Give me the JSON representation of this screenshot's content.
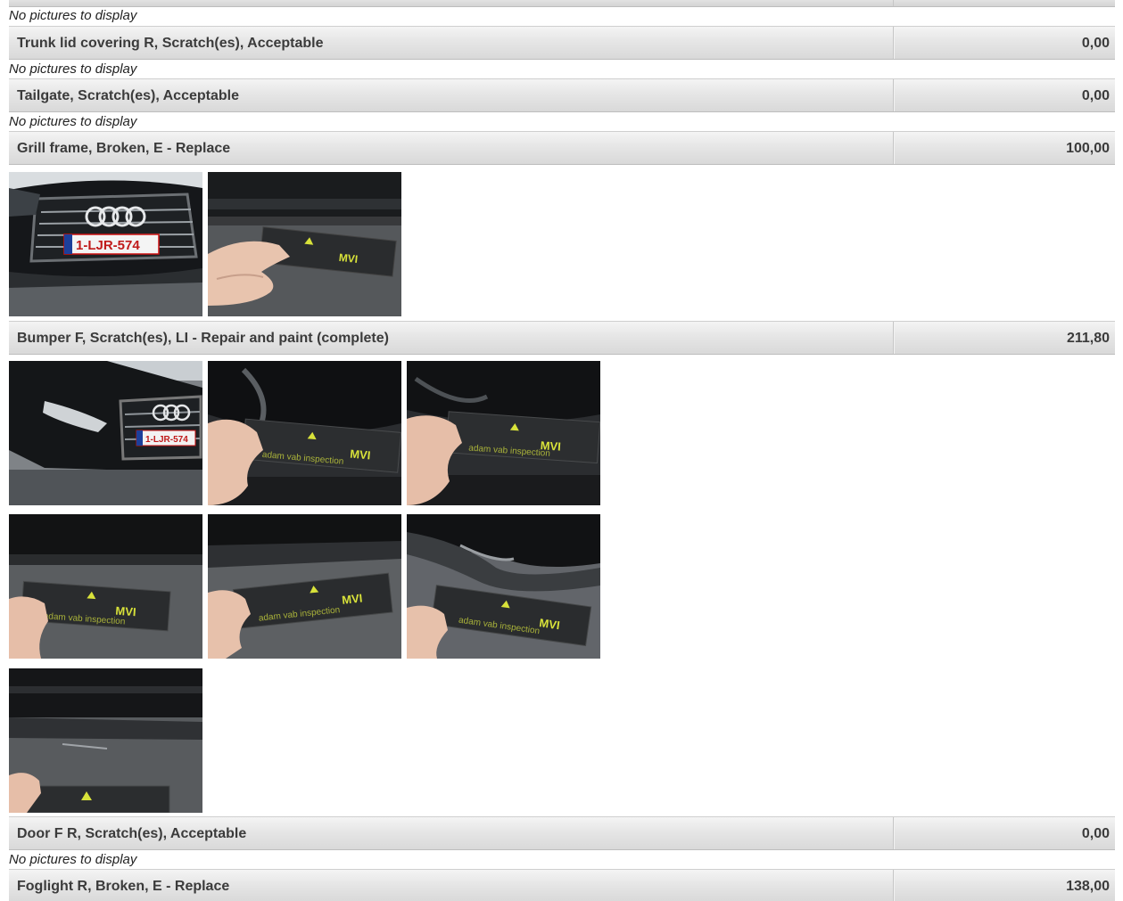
{
  "no_pictures_text": "No pictures to display",
  "items": [
    {
      "description": "Trunk lid covering R, Scratch(es), Acceptable",
      "amount": "0,00"
    },
    {
      "description": "Tailgate, Scratch(es), Acceptable",
      "amount": "0,00"
    },
    {
      "description": "Grill frame, Broken, E - Replace",
      "amount": "100,00"
    },
    {
      "description": "Bumper F, Scratch(es), LI - Repair and paint (complete)",
      "amount": "211,80"
    },
    {
      "description": "Door F R, Scratch(es), Acceptable",
      "amount": "0,00"
    },
    {
      "description": "Foglight R, Broken, E - Replace",
      "amount": "138,00"
    }
  ],
  "photos": {
    "car_plate_text": "1-LJR-574",
    "car_plate_text_2": "1-LJR-574",
    "ruler_brand_text": "MVI",
    "ruler_caption_text": "adam vab inspection"
  },
  "colors": {
    "bar_text": "#3b3b3b",
    "bar_bg": "#e6e6e6",
    "ruler_mark": "#d8e23a"
  }
}
